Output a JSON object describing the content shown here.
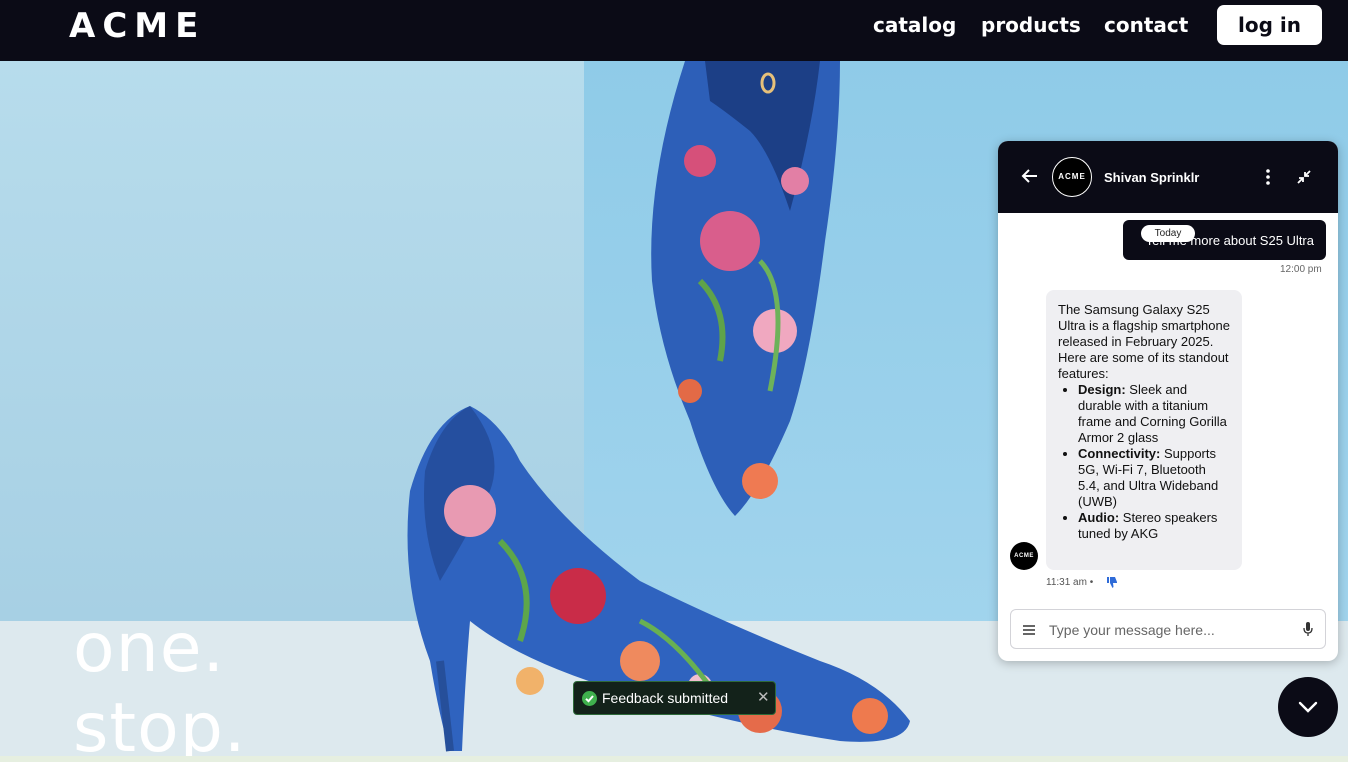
{
  "header": {
    "logo": "ACME",
    "nav": [
      "catalog",
      "products",
      "contact"
    ],
    "login_label": "log in"
  },
  "hero": {
    "line1": "one.",
    "line2": "stop."
  },
  "toast": {
    "text": "Feedback submitted",
    "close_symbol": "✕"
  },
  "chat": {
    "agent_name": "Shivan Sprinklr",
    "avatar_text": "ACME",
    "date_pill": "Today",
    "user_message": "Tell me more about S25 Ultra",
    "user_time": "12:00 pm",
    "bot_intro": "The Samsung Galaxy S25 Ultra is a flagship smartphone released in February 2025. Here are some of its standout features:",
    "bot_features": [
      {
        "title": "Design:",
        "text": " Sleek and durable with a titanium frame and Corning Gorilla Armor 2 glass"
      },
      {
        "title": "Connectivity:",
        "text": " Supports 5G, Wi-Fi 7, Bluetooth 5.4, and Ultra Wideband (UWB)"
      },
      {
        "title": "Audio:",
        "text": " Stereo speakers tuned by AKG"
      }
    ],
    "bot_time": "11:31 am",
    "bot_time_sep": "•",
    "input_placeholder": "Type your message here..."
  },
  "icons": {
    "back": "arrow-left-icon",
    "more": "kebab-icon",
    "minimize": "minimize-icon",
    "feedback": "thumbs-down-icon",
    "menu": "hamburger-icon",
    "mic": "mic-icon",
    "fab": "chevron-down-icon"
  },
  "colors": {
    "dark": "#0b0b16",
    "accent_blue": "#2f6bd8",
    "success_green": "#3fb04d"
  }
}
